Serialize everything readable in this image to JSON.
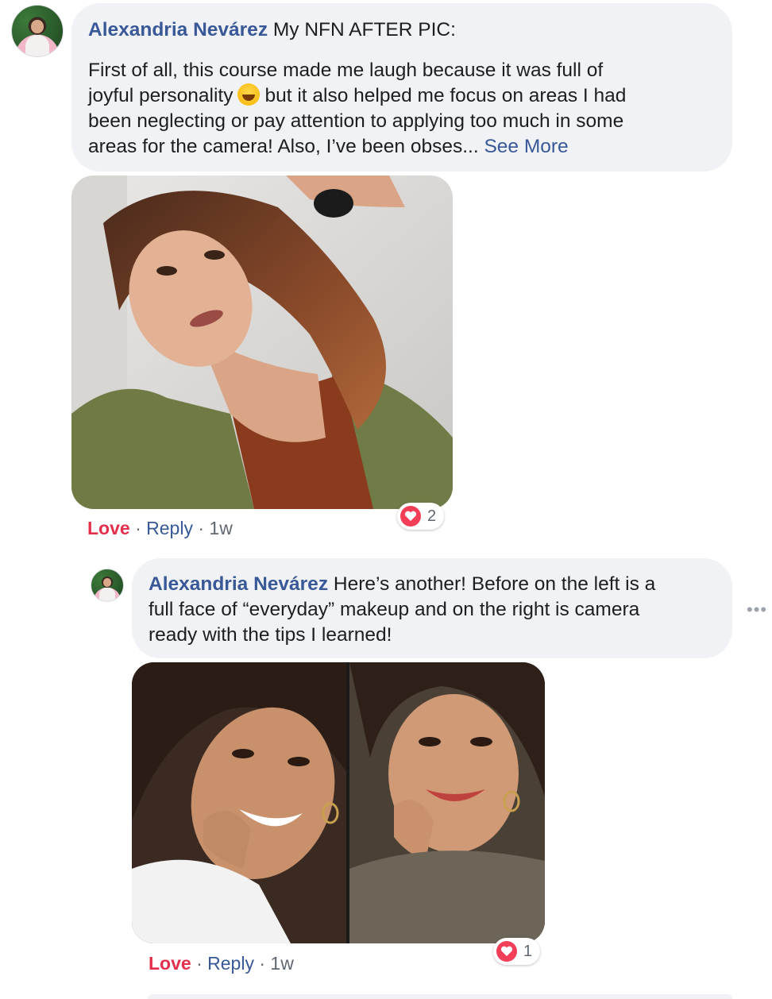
{
  "comment1": {
    "author": "Alexandria Nevárez",
    "text_line1": "My NFN AFTER PIC:",
    "body_lines": [
      "First of all, this course made me laugh because it was full of",
      "joyful personality",
      "but it also helped me focus on areas I had",
      "been neglecting or pay attention to applying too much in some",
      "areas for the camera! Also, I’ve been obses..."
    ],
    "emoji": "laughing-emoji",
    "see_more": "See More",
    "love": "Love",
    "reply": "Reply",
    "separator": "·",
    "time": "1w",
    "reaction_count": "2"
  },
  "comment2": {
    "author": "Alexandria Nevárez",
    "lines": [
      "Here’s another! Before on the left is a",
      "full face of “everyday” makeup and on the right is camera",
      "ready with the tips I learned!"
    ],
    "love": "Love",
    "reply": "Reply",
    "separator": "·",
    "time": "1w",
    "reaction_count": "1",
    "more_icon": "more-options-icon"
  },
  "colors": {
    "name": "#385898",
    "love": "#e2304c",
    "bubble": "#f0f2f5",
    "heart": "#f33e58"
  }
}
